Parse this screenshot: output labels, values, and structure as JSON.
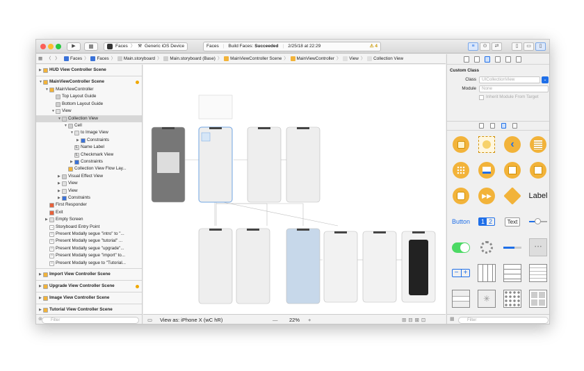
{
  "toolbar": {
    "scheme_app": "Faces",
    "scheme_device": "Generic iOS Device",
    "activity_project": "Faces",
    "activity_build_label": "Build Faces:",
    "activity_build_status": "Succeeded",
    "activity_time": "2/25/18 at 22:29",
    "warning_count": "4"
  },
  "jumpbar": [
    "Faces",
    "Faces",
    "Main.storyboard",
    "Main.storyboard (Base)",
    "MainViewController Scene",
    "MainViewController",
    "View",
    "Collection View"
  ],
  "navigator": {
    "rows": [
      {
        "label": "HUD View Controller Scene",
        "scene": true,
        "tri": "▶",
        "indent": 0,
        "icon": "#f2b33a"
      },
      {
        "label": "MainViewController Scene",
        "scene": true,
        "tri": "▼",
        "indent": 0,
        "icon": "#f2b33a",
        "dot": true
      },
      {
        "label": "MainViewController",
        "tri": "▼",
        "indent": 1,
        "icon": "#f2b33a"
      },
      {
        "label": "Top Layout Guide",
        "indent": 2,
        "icon": "#cfcfcf"
      },
      {
        "label": "Bottom Layout Guide",
        "indent": 2,
        "icon": "#cfcfcf"
      },
      {
        "label": "View",
        "tri": "▼",
        "indent": 2,
        "icon": "#e0e0e0"
      },
      {
        "label": "Collection View",
        "tri": "▼",
        "indent": 3,
        "icon": "#cfcfcf",
        "selected": true
      },
      {
        "label": "Cell",
        "tri": "▼",
        "indent": 4,
        "icon": "#cfcfcf"
      },
      {
        "label": "to Image View",
        "tri": "▼",
        "indent": 5,
        "icon": "#e0e0e0"
      },
      {
        "label": "Constraints",
        "tri": "▶",
        "indent": 6,
        "icon": "#3a72d8"
      },
      {
        "label": "Name Label",
        "indent": 5,
        "icon": "#e0e0e0",
        "glyph": "L"
      },
      {
        "label": "Checkmark View",
        "indent": 5,
        "icon": "#e0e0e0",
        "glyph": "L"
      },
      {
        "label": "Constraints",
        "tri": "▶",
        "indent": 5,
        "icon": "#3a72d8"
      },
      {
        "label": "Collection View Flow Lay...",
        "indent": 4,
        "icon": "#f2b33a"
      },
      {
        "label": "Visual Effect View",
        "tri": "▶",
        "indent": 3,
        "icon": "#cfcfcf"
      },
      {
        "label": "View",
        "tri": "▶",
        "indent": 3,
        "icon": "#e0e0e0"
      },
      {
        "label": "View",
        "tri": "▶",
        "indent": 3,
        "icon": "#e0e0e0"
      },
      {
        "label": "Constraints",
        "tri": "▶",
        "indent": 3,
        "icon": "#3a72d8"
      },
      {
        "label": "First Responder",
        "indent": 1,
        "icon": "#e8613a"
      },
      {
        "label": "Exit",
        "indent": 1,
        "icon": "#e8613a"
      },
      {
        "label": "Empty Screen",
        "tri": "▶",
        "indent": 1,
        "icon": "#e0e0e0"
      },
      {
        "label": "Storyboard Entry Point",
        "indent": 1,
        "icon": "#ffffff",
        "glyph": "→"
      },
      {
        "label": "Present Modally segue \"intro\" to \"...",
        "indent": 1,
        "icon": "#ffffff",
        "glyph": "○"
      },
      {
        "label": "Present Modally segue \"tutorial\" ...",
        "indent": 1,
        "icon": "#ffffff",
        "glyph": "○"
      },
      {
        "label": "Present Modally segue \"upgrade\"...",
        "indent": 1,
        "icon": "#ffffff",
        "glyph": "○"
      },
      {
        "label": "Present Modally segue \"import\" to...",
        "indent": 1,
        "icon": "#ffffff",
        "glyph": "○"
      },
      {
        "label": "Present Modally segue to \"Tutorial...",
        "indent": 1,
        "icon": "#ffffff",
        "glyph": "○"
      },
      {
        "label": "Import View Controller Scene",
        "scene": true,
        "tri": "▶",
        "indent": 0,
        "icon": "#f2b33a"
      },
      {
        "label": "Upgrade View Controller Scene",
        "scene": true,
        "tri": "▶",
        "indent": 0,
        "icon": "#f2b33a",
        "dot": true
      },
      {
        "label": "Image View Controller Scene",
        "scene": true,
        "tri": "▶",
        "indent": 0,
        "icon": "#f2b33a"
      },
      {
        "label": "Tutorial View Controller Scene",
        "scene": true,
        "tri": "▶",
        "indent": 0,
        "icon": "#f2b33a"
      }
    ],
    "filter_placeholder": "Filter"
  },
  "canvas": {
    "view_as": "View as: iPhone X (wC hR)",
    "zoom": "22%",
    "zoom_minus": "—",
    "zoom_plus": "+"
  },
  "inspector": {
    "section_title": "Custom Class",
    "class_label": "Class",
    "class_placeholder": "UICollectionView",
    "module_label": "Module",
    "module_placeholder": "None",
    "inherit_label": "Inherit Module From Target"
  },
  "library": {
    "label_text": "Label",
    "button_text": "Button",
    "segment_1": "1",
    "segment_2": "2",
    "text_field": "Text",
    "filter_placeholder": "Filter"
  },
  "colors": {
    "accent": "#1f6fe8",
    "scene_icon": "#f2b33a",
    "warning": "#f0a800",
    "constraint": "#3a72d8"
  }
}
